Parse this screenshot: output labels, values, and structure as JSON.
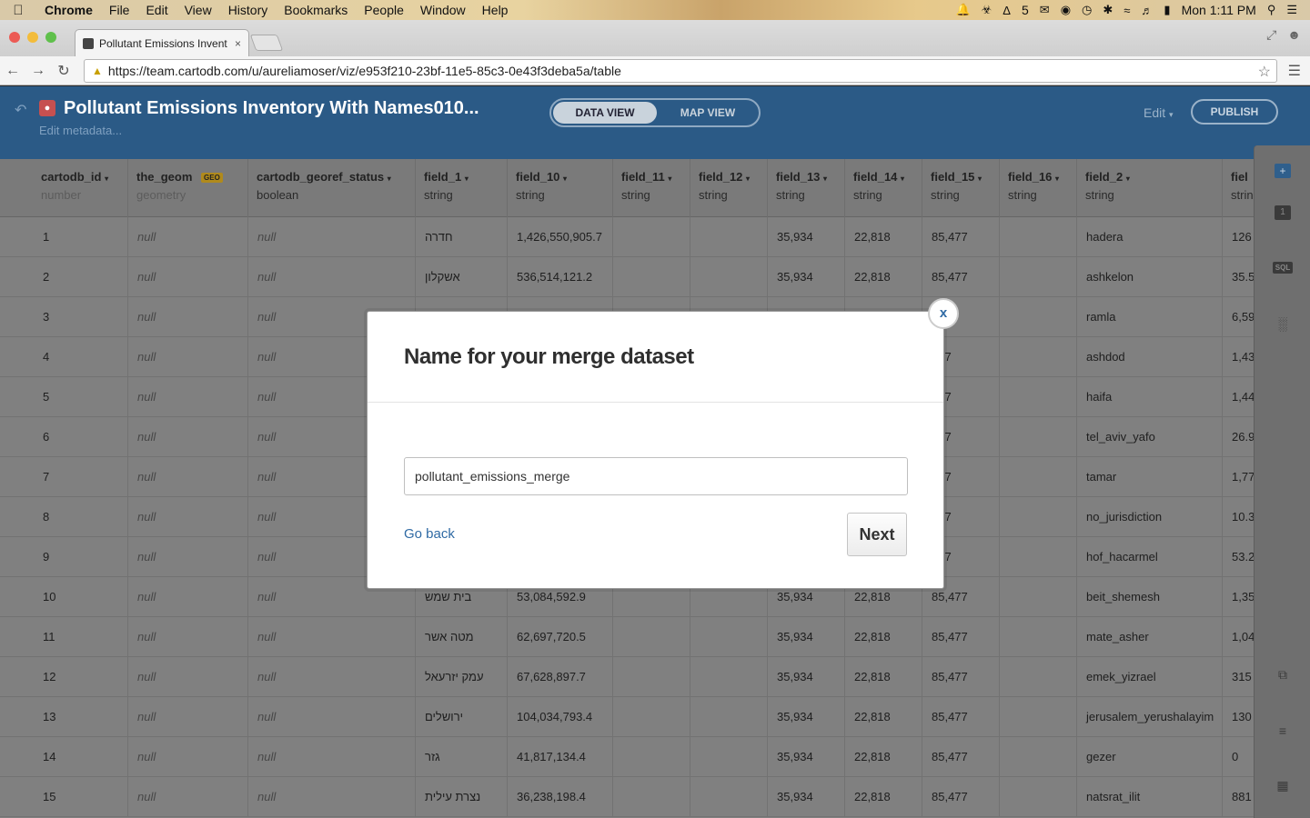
{
  "menubar": {
    "app": "Chrome",
    "items": [
      "File",
      "Edit",
      "View",
      "History",
      "Bookmarks",
      "People",
      "Window",
      "Help"
    ],
    "badge_count": "5",
    "clock": "Mon 1:11 PM"
  },
  "browser": {
    "tab_title": "Pollutant Emissions Invent",
    "url": "https://team.cartodb.com/u/aureliamoser/viz/e953f210-23bf-11e5-85c3-0e43f3deba5a/table"
  },
  "header": {
    "title": "Pollutant Emissions Inventory With Names010...",
    "metadata_link": "Edit metadata...",
    "data_view": "DATA VIEW",
    "map_view": "MAP VIEW",
    "edit": "Edit",
    "publish": "PUBLISH"
  },
  "table": {
    "columns": [
      {
        "name": "cartodb_id",
        "type": "number"
      },
      {
        "name": "the_geom",
        "type": "geometry",
        "badge": "GEO"
      },
      {
        "name": "cartodb_georef_status",
        "type": "boolean"
      },
      {
        "name": "field_1",
        "type": "string"
      },
      {
        "name": "field_10",
        "type": "string"
      },
      {
        "name": "field_11",
        "type": "string"
      },
      {
        "name": "field_12",
        "type": "string"
      },
      {
        "name": "field_13",
        "type": "string"
      },
      {
        "name": "field_14",
        "type": "string"
      },
      {
        "name": "field_15",
        "type": "string"
      },
      {
        "name": "field_16",
        "type": "string"
      },
      {
        "name": "field_2",
        "type": "string"
      },
      {
        "name": "fiel",
        "type": "strin"
      }
    ],
    "rows": [
      [
        "1",
        "null",
        "null",
        "חדרה",
        "1,426,550,905.7",
        "",
        "",
        "35,934",
        "22,818",
        "85,477",
        "",
        "hadera",
        "126"
      ],
      [
        "2",
        "null",
        "null",
        "אשקלון",
        "536,514,121.2",
        "",
        "",
        "35,934",
        "22,818",
        "85,477",
        "",
        "ashkelon",
        "35.5"
      ],
      [
        "3",
        "null",
        "null",
        "",
        "",
        "",
        "",
        "",
        "",
        "477",
        "",
        "ramla",
        "6,59"
      ],
      [
        "4",
        "null",
        "null",
        "",
        "",
        "",
        "",
        "",
        "",
        "477",
        "",
        "ashdod",
        "1,43"
      ],
      [
        "5",
        "null",
        "null",
        "",
        "",
        "",
        "",
        "",
        "",
        "477",
        "",
        "haifa",
        "1,44"
      ],
      [
        "6",
        "null",
        "null",
        "",
        "",
        "",
        "",
        "",
        "",
        "477",
        "",
        "tel_aviv_yafo",
        "26.9"
      ],
      [
        "7",
        "null",
        "null",
        "",
        "",
        "",
        "",
        "",
        "",
        "477",
        "",
        "tamar",
        "1,77"
      ],
      [
        "8",
        "null",
        "null",
        "",
        "",
        "",
        "",
        "",
        "",
        "477",
        "",
        "no_jurisdiction",
        "10.3"
      ],
      [
        "9",
        "null",
        "null",
        "",
        "",
        "",
        "",
        "",
        "",
        "477",
        "",
        "hof_hacarmel",
        "53.2"
      ],
      [
        "10",
        "null",
        "null",
        "בית שמש",
        "53,084,592.9",
        "",
        "",
        "35,934",
        "22,818",
        "85,477",
        "",
        "beit_shemesh",
        "1,35"
      ],
      [
        "11",
        "null",
        "null",
        "מטה אשר",
        "62,697,720.5",
        "",
        "",
        "35,934",
        "22,818",
        "85,477",
        "",
        "mate_asher",
        "1,04"
      ],
      [
        "12",
        "null",
        "null",
        "עמק יזרעאל",
        "67,628,897.7",
        "",
        "",
        "35,934",
        "22,818",
        "85,477",
        "",
        "emek_yizrael",
        "315"
      ],
      [
        "13",
        "null",
        "null",
        "ירושלים",
        "104,034,793.4",
        "",
        "",
        "35,934",
        "22,818",
        "85,477",
        "",
        "jerusalem_yerushalayim",
        "130"
      ],
      [
        "14",
        "null",
        "null",
        "גזר",
        "41,817,134.4",
        "",
        "",
        "35,934",
        "22,818",
        "85,477",
        "",
        "gezer",
        "0"
      ],
      [
        "15",
        "null",
        "null",
        "נצרת עילית",
        "36,238,198.4",
        "",
        "",
        "35,934",
        "22,818",
        "85,477",
        "",
        "natsrat_ilit",
        "881"
      ]
    ]
  },
  "sidebar": {
    "sql_label": "SQL",
    "layer_count": "1"
  },
  "modal": {
    "title": "Name for your merge dataset",
    "input_value": "pollutant_emissions_merge",
    "go_back": "Go back",
    "next": "Next",
    "close": "x"
  }
}
